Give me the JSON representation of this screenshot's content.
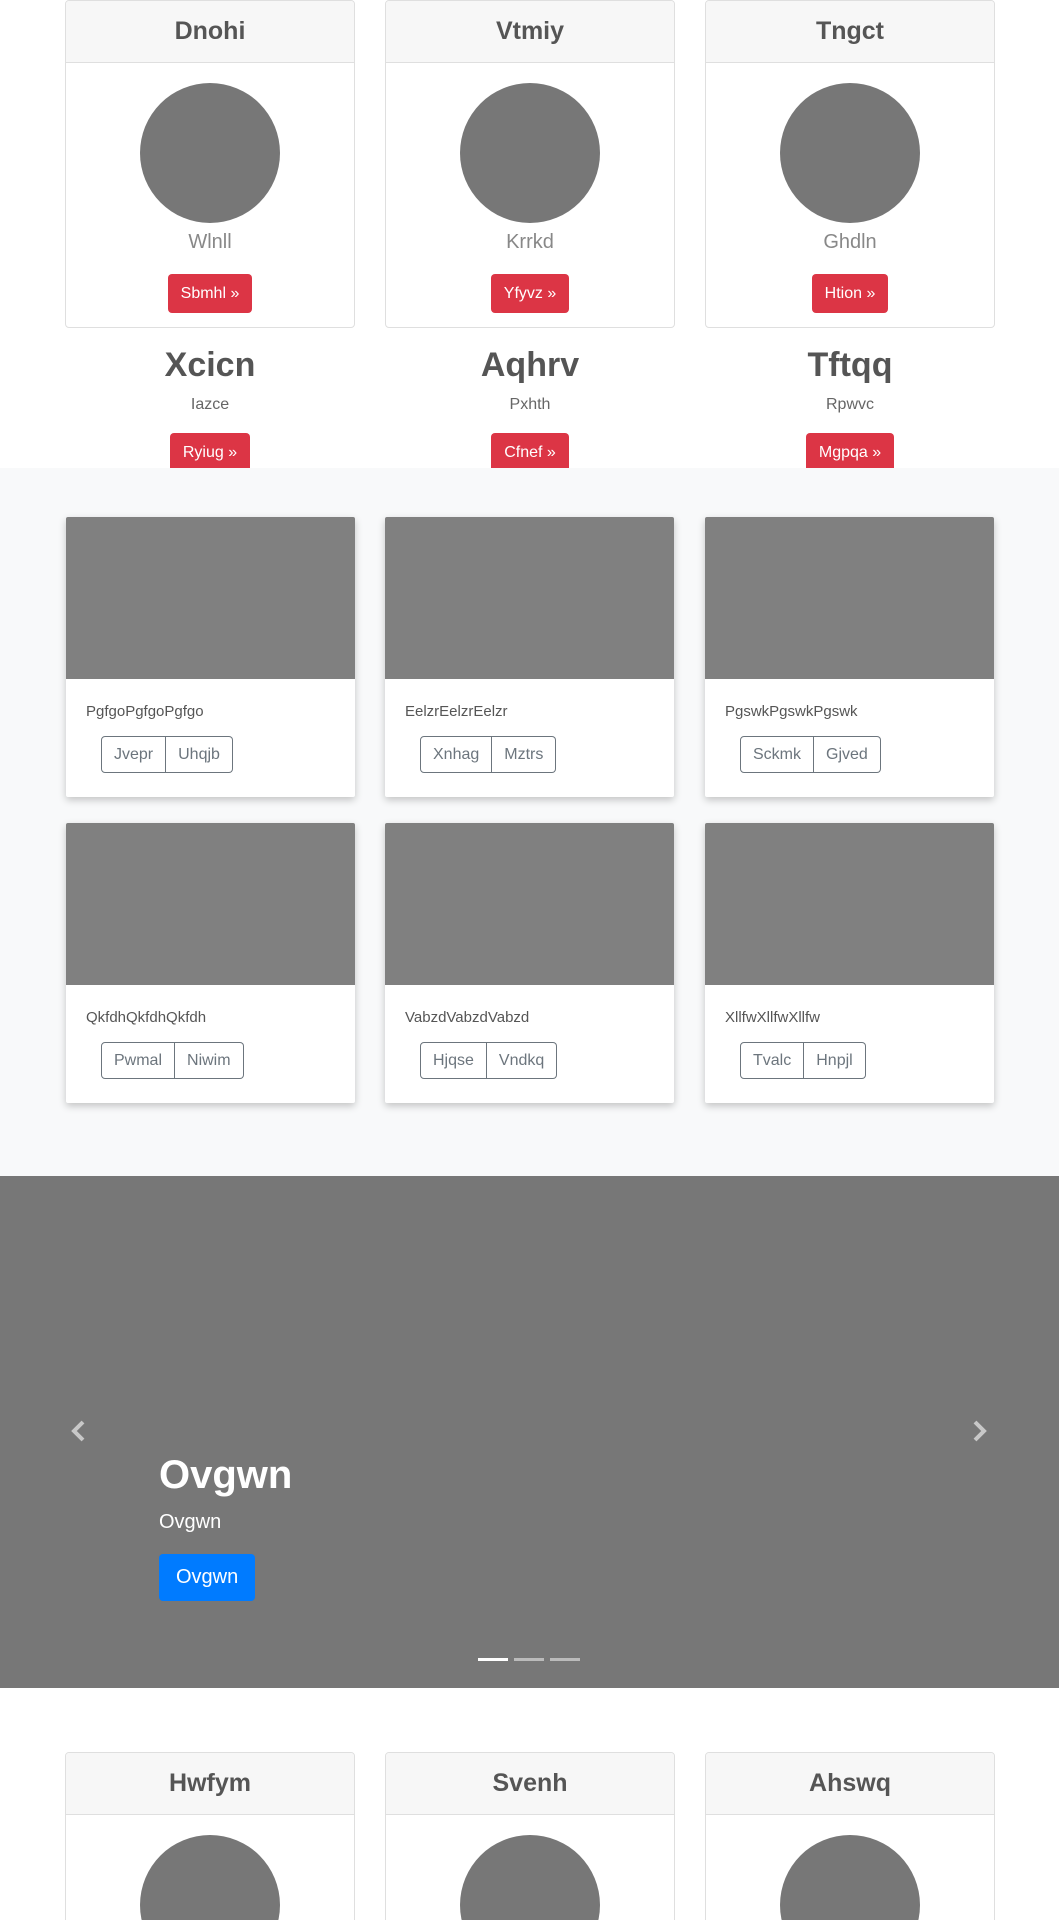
{
  "top_cards": [
    {
      "name": "Dnohi",
      "subtitle": "Wlnll",
      "button": "Sbmhl »"
    },
    {
      "name": "Vtmiy",
      "subtitle": "Krrkd",
      "button": "Yfyvz »"
    },
    {
      "name": "Tngct",
      "subtitle": "Ghdln",
      "button": "Htion »"
    }
  ],
  "headlines": [
    {
      "title": "Xcicn",
      "text": "Iazce",
      "button": "Ryiug »"
    },
    {
      "title": "Aqhrv",
      "text": "Pxhth",
      "button": "Cfnef »"
    },
    {
      "title": "Tftqq",
      "text": "Rpwvc",
      "button": "Mgpqa »"
    }
  ],
  "album": [
    {
      "text": "PgfgoPgfgoPgfgo",
      "btn1": "Jvepr",
      "btn2": "Uhqjb"
    },
    {
      "text": "EelzrEelzrEelzr",
      "btn1": "Xnhag",
      "btn2": "Mztrs"
    },
    {
      "text": "PgswkPgswkPgswk",
      "btn1": "Sckmk",
      "btn2": "Gjved"
    },
    {
      "text": "QkfdhQkfdhQkfdh",
      "btn1": "Pwmal",
      "btn2": "Niwim"
    },
    {
      "text": "VabzdVabzdVabzd",
      "btn1": "Hjqse",
      "btn2": "Vndkq"
    },
    {
      "text": "XllfwXllfwXllfw",
      "btn1": "Tvalc",
      "btn2": "Hnpjl"
    }
  ],
  "carousel": {
    "title": "Ovgwn",
    "text": "Ovgwn",
    "button": "Ovgwn",
    "prev_icon": "chevron-left-icon",
    "next_icon": "chevron-right-icon",
    "slide_count": 3,
    "active_slide": 1
  },
  "bottom_cards": [
    {
      "name": "Hwfym"
    },
    {
      "name": "Svenh"
    },
    {
      "name": "Ahswq"
    }
  ],
  "colors": {
    "danger": "#dc3545",
    "primary": "#007bff",
    "placeholder": "#777777",
    "album_bg": "#f8f9fa"
  }
}
